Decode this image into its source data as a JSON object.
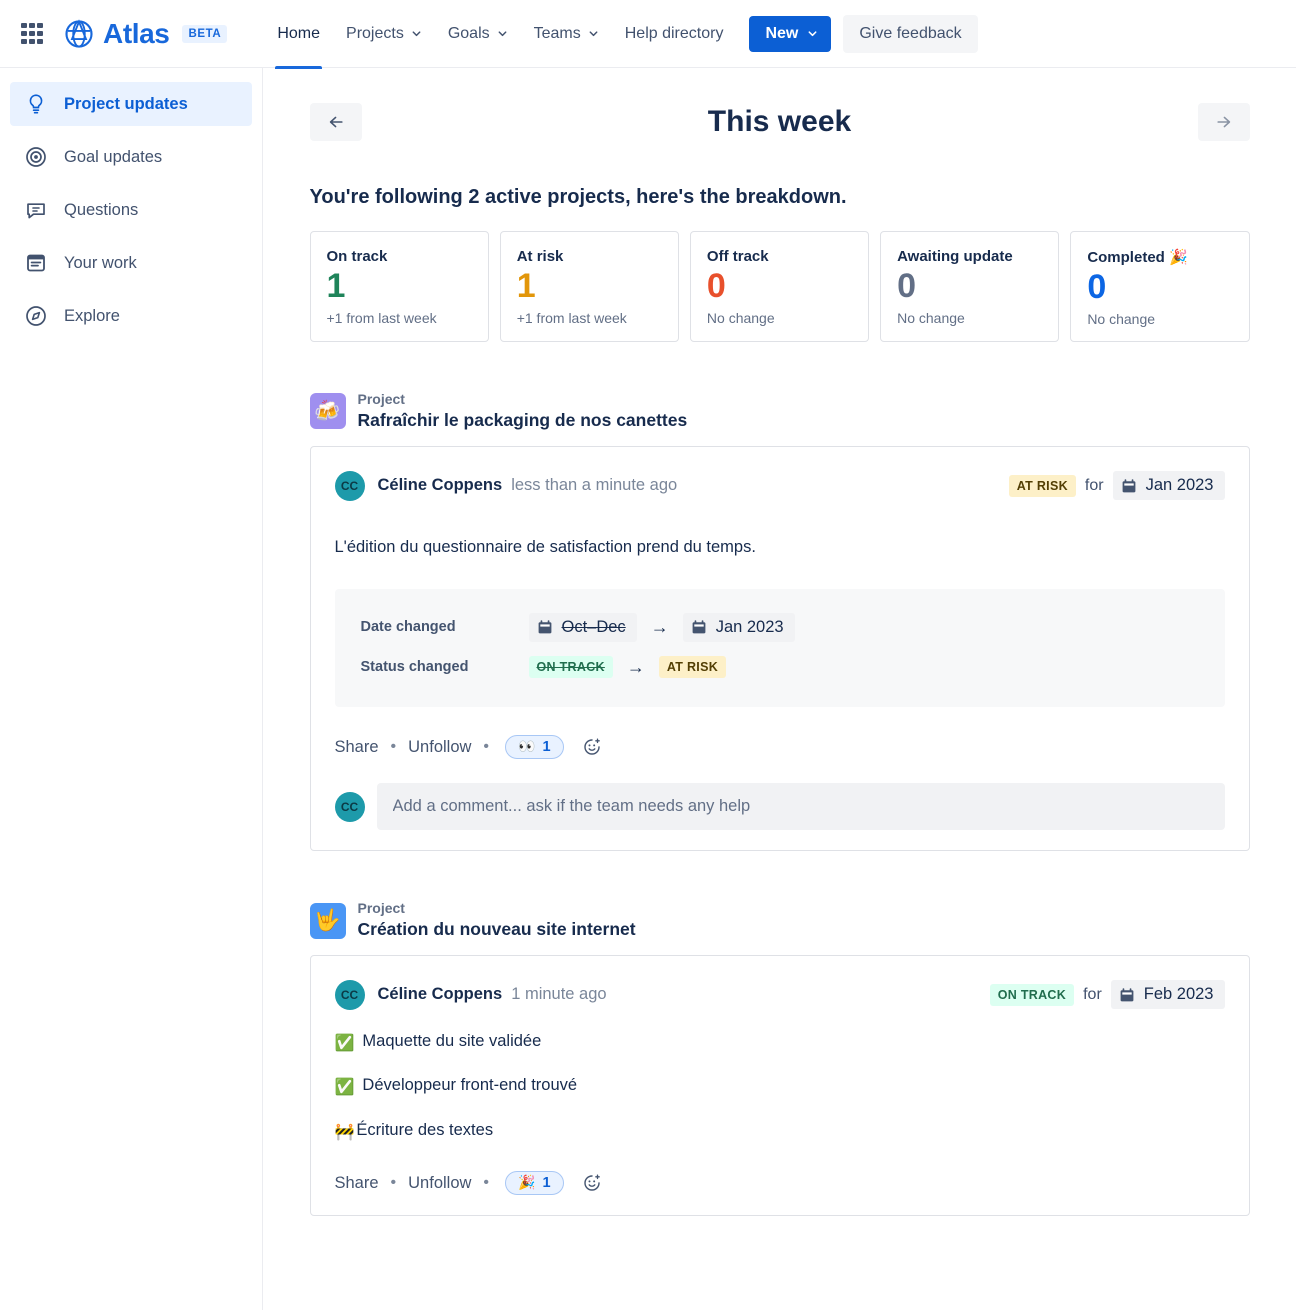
{
  "topnav": {
    "app_switcher_icon": "grid-apps-icon",
    "brand": {
      "logo_icon": "atlas-globe-logo",
      "name": "Atlas",
      "badge": "BETA"
    },
    "links": [
      {
        "label": "Home",
        "has_chevron": false,
        "active": true
      },
      {
        "label": "Projects",
        "has_chevron": true,
        "active": false
      },
      {
        "label": "Goals",
        "has_chevron": true,
        "active": false
      },
      {
        "label": "Teams",
        "has_chevron": true,
        "active": false
      },
      {
        "label": "Help directory",
        "has_chevron": false,
        "active": false
      }
    ],
    "new_button": {
      "label": "New",
      "chevron_icon": "chevron-down-icon",
      "color": "#0c5fd4"
    },
    "feedback_button": {
      "label": "Give feedback"
    }
  },
  "sidebar": {
    "items": [
      {
        "label": "Project updates",
        "icon": "lightbulb-icon",
        "active": true
      },
      {
        "label": "Goal updates",
        "icon": "target-icon",
        "active": false
      },
      {
        "label": "Questions",
        "icon": "speech-bubble-icon",
        "active": false
      },
      {
        "label": "Your work",
        "icon": "document-list-icon",
        "active": false
      },
      {
        "label": "Explore",
        "icon": "compass-icon",
        "active": false
      }
    ]
  },
  "page": {
    "title": "This week",
    "prev_icon": "arrow-left-icon",
    "next_icon": "arrow-right-icon",
    "subheading": "You're following 2 active projects, here's the breakdown."
  },
  "stats": [
    {
      "label": "On track",
      "value": "1",
      "color": "#1f845a",
      "sub": "+1 from last week"
    },
    {
      "label": "At risk",
      "value": "1",
      "color": "#e2960a",
      "sub": "+1 from last week"
    },
    {
      "label": "Off track",
      "value": "0",
      "color": "#e8502c",
      "sub": "No change"
    },
    {
      "label": "Awaiting update",
      "value": "0",
      "color": "#626f86",
      "sub": "No change"
    },
    {
      "label": "Completed 🎉",
      "value": "0",
      "color": "#0c66e4",
      "sub": "No change"
    }
  ],
  "projects": [
    {
      "kicker": "Project",
      "name": "Rafraîchir le packaging de nos canettes",
      "emoji": "🍻",
      "emoji_name": "beer-mugs-emoji",
      "emoji_bg": "#9f8fef",
      "update": {
        "avatar_initials": "CC",
        "author": "Céline Coppens",
        "timeago": "less than a minute ago",
        "status_label": "AT RISK",
        "status_kind": "atrisk",
        "for_word": "for",
        "date_label": "Jan 2023",
        "body": "L'édition du questionnaire de satisfaction prend du temps.",
        "changes": [
          {
            "label": "Date changed",
            "from": {
              "kind": "date",
              "text": "Oct–Dec",
              "strike": true
            },
            "arrow": "→",
            "to": {
              "kind": "date",
              "text": "Jan 2023",
              "strike": false
            }
          },
          {
            "label": "Status changed",
            "from": {
              "kind": "ontrack",
              "text": "ON TRACK",
              "strike": true
            },
            "arrow": "→",
            "to": {
              "kind": "atrisk",
              "text": "AT RISK",
              "strike": false
            }
          }
        ],
        "actions": {
          "share": "Share",
          "follow": "Unfollow",
          "separator": "•"
        },
        "reaction": {
          "emoji": "👀",
          "emoji_name": "eyes-emoji",
          "count": "1"
        },
        "add_reaction_icon": "add-reaction-smiley-icon",
        "comment": {
          "avatar_initials": "CC",
          "placeholder": "Add a comment... ask if the team needs any help"
        }
      }
    },
    {
      "kicker": "Project",
      "name": "Création du nouveau site internet",
      "emoji": "🤟",
      "emoji_name": "love-you-gesture-emoji",
      "emoji_bg": "#4a96f5",
      "update": {
        "avatar_initials": "CC",
        "author": "Céline Coppens",
        "timeago": "1 minute ago",
        "status_label": "ON TRACK",
        "status_kind": "ontrack",
        "for_word": "for",
        "date_label": "Feb 2023",
        "bullets": [
          {
            "emoji": "✅",
            "emoji_name": "check-mark-button-emoji",
            "text": "Maquette du site validée"
          },
          {
            "emoji": "✅",
            "emoji_name": "check-mark-button-emoji",
            "text": "Développeur front-end trouvé"
          },
          {
            "emoji": "🚧",
            "emoji_name": "construction-emoji",
            "text": "Écriture des textes"
          }
        ],
        "actions": {
          "share": "Share",
          "follow": "Unfollow",
          "separator": "•"
        },
        "reaction": {
          "emoji": "🎉",
          "emoji_name": "party-popper-emoji",
          "count": "1"
        },
        "add_reaction_icon": "add-reaction-smiley-icon"
      }
    }
  ]
}
